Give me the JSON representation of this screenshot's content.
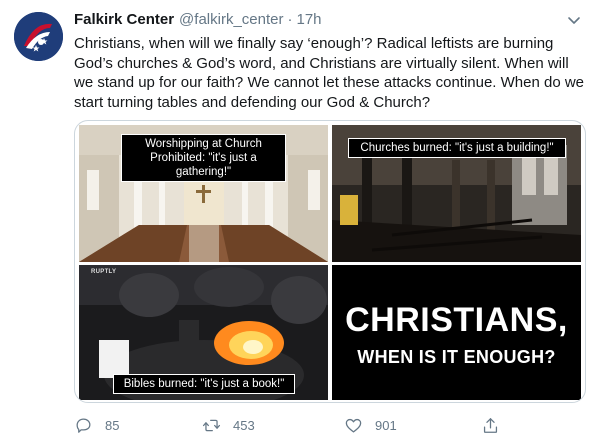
{
  "tweet": {
    "display_name": "Falkirk Center",
    "handle": "@falkirk_center",
    "separator": "·",
    "time": "17h",
    "text": "Christians, when will we finally say ‘enough’? Radical leftists are burning God’s churches & God’s word, and Christians are virtually silent. When will we stand up for our faith? We cannot let these attacks continue. When do we start turning tables and defending our God & Church?"
  },
  "media": {
    "tiles": [
      {
        "caption_line1": "Worshipping at Church",
        "caption_line2": "Prohibited: \"it's just a gathering!\""
      },
      {
        "caption": "Churches burned: \"it's just a building!\""
      },
      {
        "watermark": "RUPTLY",
        "caption": "Bibles burned: \"it's just a book!\""
      },
      {
        "headline": "CHRISTIANS,",
        "subline": "WHEN IS IT ENOUGH?"
      }
    ]
  },
  "actions": {
    "reply_count": "85",
    "retweet_count": "453",
    "like_count": "901"
  },
  "icons": {
    "avatar": "falkirk-logo-icon",
    "caret": "chevron-down-icon",
    "reply": "reply-icon",
    "retweet": "retweet-icon",
    "like": "heart-icon",
    "share": "share-icon"
  },
  "colors": {
    "text": "#14171a",
    "muted": "#657786",
    "border": "#ccd6dd",
    "avatar_bg": "#1f3d7a"
  }
}
